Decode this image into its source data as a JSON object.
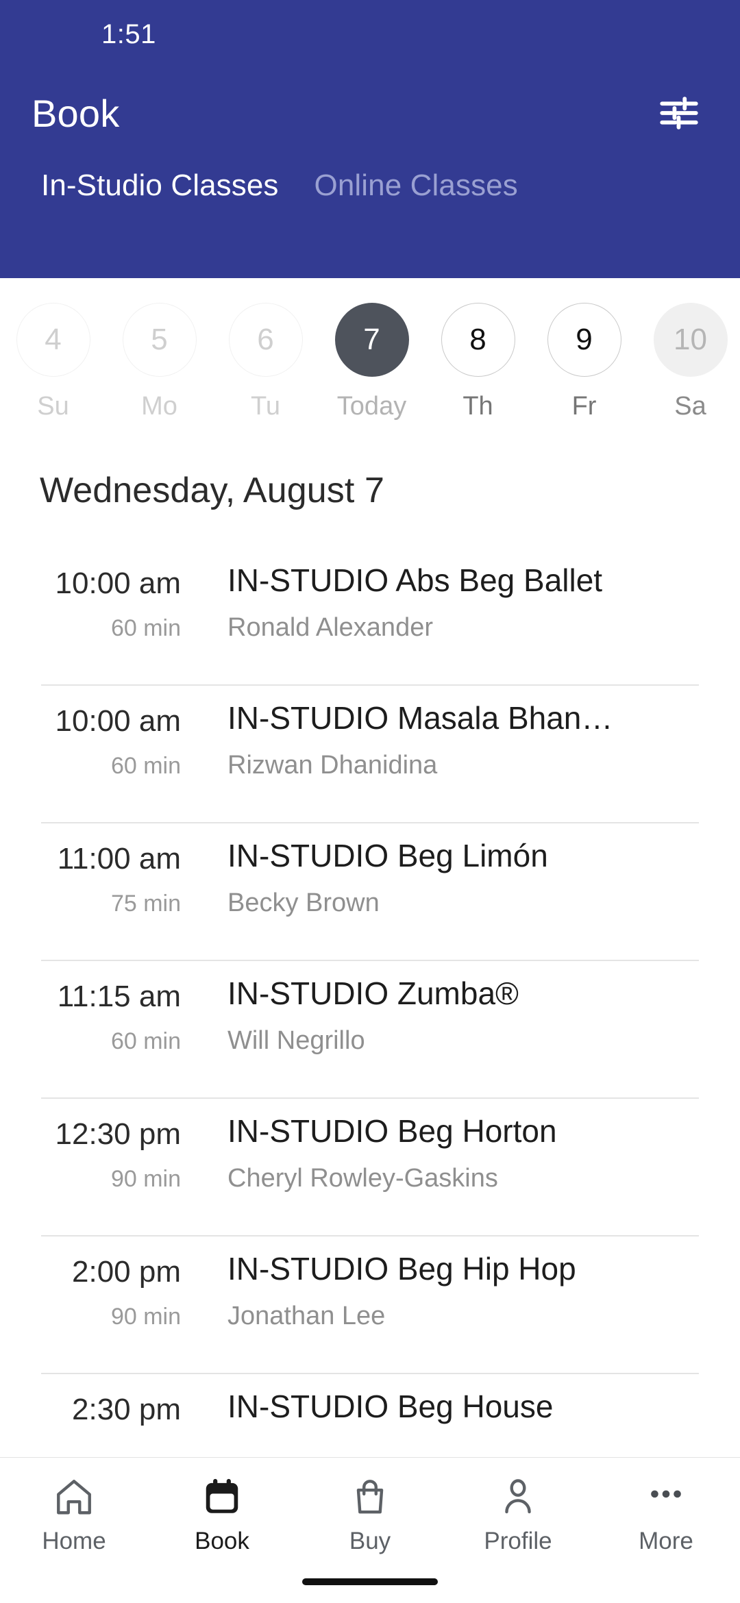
{
  "status": {
    "time": "1:51"
  },
  "appbar": {
    "title": "Book",
    "filter_icon": "tune-sliders-icon"
  },
  "tabs": [
    {
      "label": "In-Studio Classes",
      "active": true
    },
    {
      "label": "Online Classes",
      "active": false
    }
  ],
  "datestrip": [
    {
      "num": "4",
      "label": "Su",
      "state": "past"
    },
    {
      "num": "5",
      "label": "Mo",
      "state": "past"
    },
    {
      "num": "6",
      "label": "Tu",
      "state": "past"
    },
    {
      "num": "7",
      "label": "Today",
      "state": "today"
    },
    {
      "num": "8",
      "label": "Th",
      "state": "avail"
    },
    {
      "num": "9",
      "label": "Fr",
      "state": "avail"
    },
    {
      "num": "10",
      "label": "Sa",
      "state": "edge"
    }
  ],
  "date_heading": "Wednesday, August 7",
  "classes": [
    {
      "time": "10:00 am",
      "duration": "60 min",
      "name": "IN-STUDIO Abs Beg Ballet",
      "teacher": "Ronald Alexander"
    },
    {
      "time": "10:00 am",
      "duration": "60 min",
      "name": "IN-STUDIO Masala Bhan…",
      "teacher": "Rizwan Dhanidina"
    },
    {
      "time": "11:00 am",
      "duration": "75 min",
      "name": "IN-STUDIO Beg Limón",
      "teacher": "Becky Brown"
    },
    {
      "time": "11:15 am",
      "duration": "60 min",
      "name": "IN-STUDIO Zumba®",
      "teacher": "Will Negrillo"
    },
    {
      "time": "12:30 pm",
      "duration": "90 min",
      "name": "IN-STUDIO Beg Horton",
      "teacher": "Cheryl Rowley-Gaskins"
    },
    {
      "time": "2:00 pm",
      "duration": "90 min",
      "name": "IN-STUDIO Beg Hip Hop",
      "teacher": "Jonathan Lee"
    },
    {
      "time": "2:30 pm",
      "duration": "",
      "name": "IN-STUDIO Beg House",
      "teacher": ""
    }
  ],
  "bottomnav": [
    {
      "label": "Home",
      "icon": "home-icon",
      "active": false
    },
    {
      "label": "Book",
      "icon": "calendar-icon",
      "active": true
    },
    {
      "label": "Buy",
      "icon": "bag-icon",
      "active": false
    },
    {
      "label": "Profile",
      "icon": "person-icon",
      "active": false
    },
    {
      "label": "More",
      "icon": "ellipsis-icon",
      "active": false
    }
  ],
  "colors": {
    "header_blue": "#333b92",
    "tab_inactive": "#9aa0d2",
    "today_circle": "#4e535c",
    "divider": "#e4e4e4",
    "muted_text": "#9a9a9a"
  }
}
